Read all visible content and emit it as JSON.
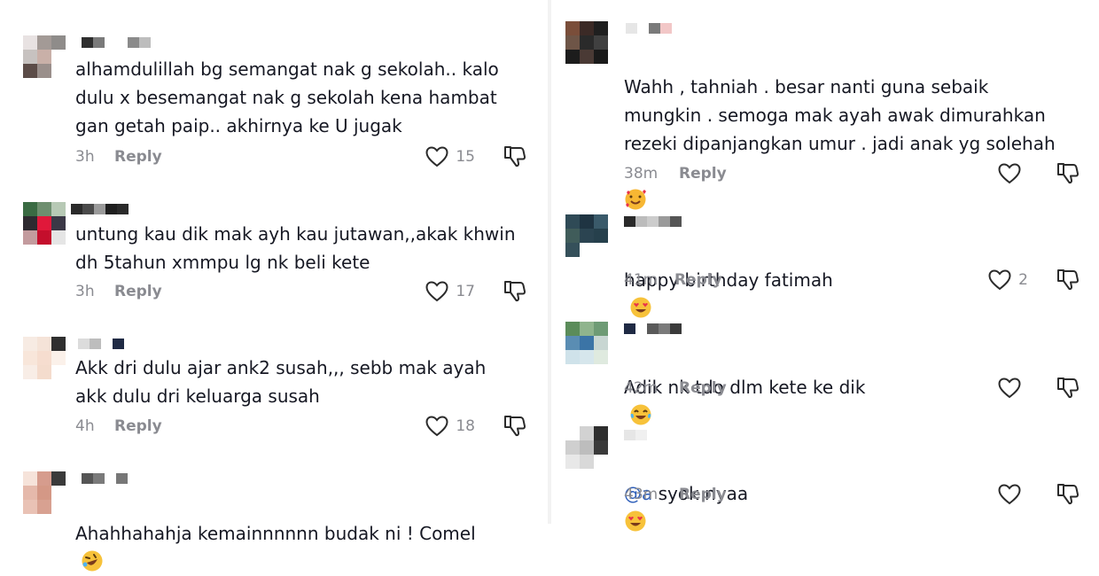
{
  "left": {
    "comments": [
      {
        "text": "alhamdulillah bg semangat nak g sekolah.. kalo\ndulu x besemangat nak g sekolah kena hambat\ngan getah paip.. akhirnya ke U jugak",
        "time": "3h",
        "reply": "Reply",
        "likes": "15",
        "avatar_colors": [
          "#e8e2e2",
          "#a39a96",
          "#8f8c8a",
          "#c7c2c0",
          "#c9b0a8",
          "#ffffff",
          "#5c4c48",
          "#9a8f8b",
          "#ffffff"
        ],
        "name_colors": [
          "#2e2e2e",
          "#7a7a7a",
          "#ffffff",
          "#ffffff",
          "#8a8a8a",
          "#bdbdbd"
        ]
      },
      {
        "text": "untung kau dik mak ayh kau jutawan,,akak khwin\ndh 5tahun xmmpu lg nk beli kete",
        "time": "3h",
        "reply": "Reply",
        "likes": "17",
        "avatar_colors": [
          "#3a6b43",
          "#6e8f6f",
          "#b7c9b5",
          "#2e2a30",
          "#e0183a",
          "#3b3846",
          "#c39b9e",
          "#c40e2c",
          "#e5e5e5"
        ],
        "name_colors": [
          "#2a2a2a",
          "#4a4a4a",
          "#9a9a9a",
          "#1f1f1f",
          "#2a2a2a"
        ]
      },
      {
        "text": "Akk dri dulu ajar ank2 susah,,, sebb mak ayah\nakk dulu dri keluarga susah",
        "time": "4h",
        "reply": "Reply",
        "likes": "18",
        "avatar_colors": [
          "#f7ebe3",
          "#f5e3d8",
          "#2f2f2f",
          "#f8e6da",
          "#f6ddcf",
          "#fbf1ea",
          "#f8ede6",
          "#f4dccd",
          "#ffffff"
        ],
        "name_colors": [
          "#dcdcdc",
          "#bdbdbd",
          "#ffffff",
          "#1f2a44"
        ]
      },
      {
        "text": "Ahahhahahja kemainnnnnn budak ni ! Comel",
        "time": "",
        "reply": "",
        "likes": "",
        "avatar_colors": [
          "#f6e3da",
          "#d69c8d",
          "#3a3a3a",
          "#e5b9ab",
          "#d49886",
          "#ffffff",
          "#e9c2b5",
          "#d8a191",
          "#ffffff"
        ],
        "name_colors": [
          "#555555",
          "#7a7a7a",
          "#ffffff",
          "#777777"
        ]
      }
    ]
  },
  "right": {
    "comments": [
      {
        "text": "Wahh , tahniah . besar nanti guna sebaik\nmungkin . semoga mak ayah awak dimurahkan\nrezeki dipanjangkan umur . jadi anak yg solehah",
        "time": "38m",
        "reply": "Reply",
        "likes": "",
        "avatar_colors": [
          "#7a4e3a",
          "#3b2a26",
          "#1f1f1f",
          "#6e5547",
          "#2a2a2a",
          "#404040",
          "#1c1c1c",
          "#4a3a35",
          "#1a1a1a"
        ],
        "name_colors": [
          "#e6e6e6",
          "#ffffff",
          "#7a7a7a",
          "#f2c7c7"
        ]
      },
      {
        "text": "happy birthday fatimah",
        "time": "41m",
        "reply": "Reply",
        "likes": "2",
        "avatar_colors": [
          "#2f4a56",
          "#1f3442",
          "#3a5a6a",
          "#405c5a",
          "#2b4451",
          "#26404c",
          "#35505a",
          "#ffffff",
          "#ffffff"
        ],
        "name_colors": [
          "#2a2a2a",
          "#bcbcbc",
          "#cccccc",
          "#9a9a9a",
          "#555555"
        ]
      },
      {
        "text": "Adik nk tdo dlm kete ke dik",
        "time": "42m",
        "reply": "Reply",
        "likes": "",
        "avatar_colors": [
          "#5b8c5a",
          "#8fb48d",
          "#6e9b75",
          "#5a8db3",
          "#3b74a6",
          "#c8d6d2",
          "#cfe2ea",
          "#d6e6ec",
          "#dfeadf"
        ],
        "name_colors": [
          "#1f2a44",
          "#ffffff",
          "#5a5a5a",
          "#7a7a7a",
          "#3a3a3a"
        ]
      },
      {
        "text": "@a syok nyaa",
        "time": "43m",
        "reply": "Reply",
        "likes": "",
        "avatar_colors": [
          "#ffffff",
          "#d2d2d2",
          "#2e2e2e",
          "#cfcfcf",
          "#bdbdbd",
          "#3a3a3a",
          "#e8e8e8",
          "#d9d9d9",
          "#ffffff"
        ],
        "name_colors": [
          "#e6e6e6",
          "#f0f0f0"
        ]
      }
    ]
  },
  "icons": {
    "like": "heart-outline-icon",
    "dislike": "thumbs-down-icon"
  }
}
